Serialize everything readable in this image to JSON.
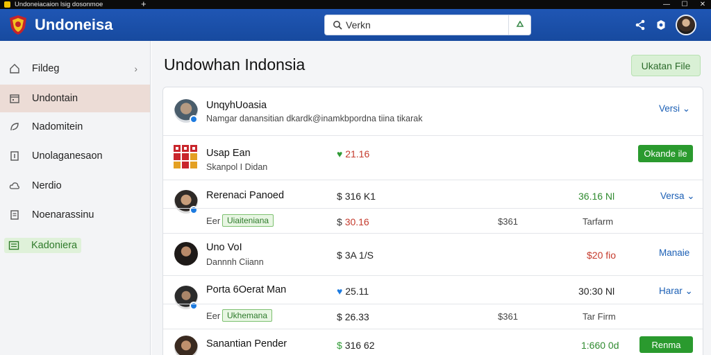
{
  "window": {
    "title": "Undoneiacaion lsig dosonmoe",
    "new_tab": "+",
    "controls": [
      "—",
      "☐",
      "✕"
    ]
  },
  "header": {
    "brand": "Undoneisa",
    "search_value": "Verkn",
    "icons": [
      "share-icon",
      "settings-icon",
      "avatar"
    ]
  },
  "sidebar": {
    "items": [
      {
        "label": "Fildeg",
        "icon": "home-icon",
        "chevron": "›"
      },
      {
        "label": "Undontain",
        "icon": "calendar-icon"
      },
      {
        "label": "Nadomitein",
        "icon": "leaf-icon"
      },
      {
        "label": "Unolaganesaon",
        "icon": "document-icon"
      },
      {
        "label": "Nerdio",
        "icon": "cloud-icon"
      },
      {
        "label": "Noenarassinu",
        "icon": "file-icon"
      },
      {
        "label": "Kadoniera",
        "icon": "list-icon"
      }
    ]
  },
  "main": {
    "title": "Undowhan Indonsia",
    "upload_label": "Ukatan File",
    "rows": [
      {
        "name": "UnqyhUoasia",
        "subtitle": "Namgar danansitian dkardk@inamkbpordna tiina tikarak",
        "action": "Versi",
        "chevron": "⌄"
      },
      {
        "name": "Usap Ean",
        "subtitle": "Skanpol I Didan",
        "value": "21.16",
        "value_prefix": "♥",
        "button": "Okande ile"
      },
      {
        "name": "Rerenaci Panoed",
        "tag_prefix": "Eer",
        "tag": "Uiaiteniana",
        "value_top": "316 K1",
        "value_top_prefix": "$",
        "value_bottom": "30.16",
        "value_bottom_prefix": "$",
        "mid": "$361",
        "right_top": "36.16 Nl",
        "right_bottom": "Tarfarm",
        "action": "Versa",
        "chevron": "⌄"
      },
      {
        "name": "Uno VoI",
        "subtitle": "Dannnh Ciiann",
        "value": "3A 1/S",
        "value_prefix": "$",
        "right": "$20 fio",
        "action": "Manaie",
        "chevron": "›"
      },
      {
        "name": "Porta 6Oerat Man",
        "tag_prefix": "Eer",
        "tag": "Ukhemana",
        "value_top": "25.11",
        "value_top_prefix": "♥",
        "value_bottom": "26.33",
        "value_bottom_prefix": "$",
        "mid": "$361",
        "right_top": "30:30 Nl",
        "right_bottom": "Tar Firm",
        "action": "Harar",
        "chevron": "⌄"
      },
      {
        "name": "Sanantian Pender",
        "value": "316 62",
        "value_prefix": "$",
        "right": "1:660 0d",
        "button": "Renma"
      }
    ]
  },
  "colors": {
    "header_blue": "#1f56b4",
    "accent_green": "#2a9a2e",
    "link_blue": "#1b5fb5",
    "value_red": "#c53a2c"
  }
}
